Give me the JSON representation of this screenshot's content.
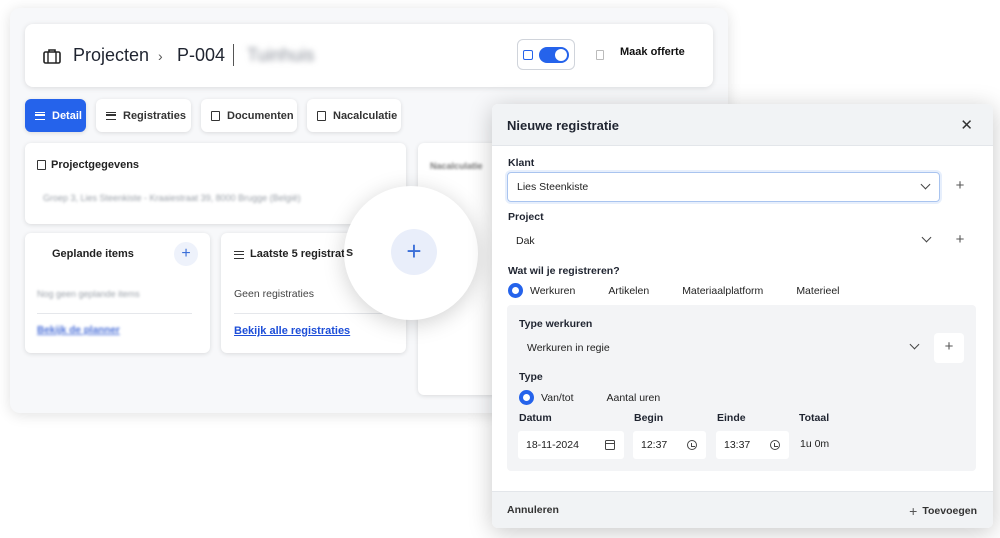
{
  "header": {
    "breadcrumb_root": "Projecten",
    "breadcrumb_separator": "›",
    "project_code": "P-004",
    "project_name": "Tuinhuis",
    "quote_button": "Maak offerte",
    "calendar_toggle_on": true
  },
  "tabs": [
    {
      "label": "Detail",
      "icon": "list-icon",
      "active": true
    },
    {
      "label": "Registraties",
      "icon": "list-icon",
      "active": false
    },
    {
      "label": "Documenten",
      "icon": "document-icon",
      "active": false
    },
    {
      "label": "Nacalculatie",
      "icon": "calculator-icon",
      "active": false
    }
  ],
  "cards": {
    "project_info": {
      "title": "Projectgegevens",
      "address": "Groep 3, Lies Steenkiste - Kraaiestraat 39, 8000 Brugge (België)"
    },
    "planned": {
      "title": "Geplande items",
      "empty": "Nog geen geplande items",
      "link": "Bekijk de planner"
    },
    "latest": {
      "title": "Laatste 5 registraties",
      "empty": "Geen registraties",
      "link": "Bekijk alle registraties"
    },
    "right": {
      "title": "Nacalculatie"
    }
  },
  "magnifier": {
    "partial_text": "s",
    "button": "+"
  },
  "modal": {
    "title": "Nieuwe registratie",
    "close": "✕",
    "customer_label": "Klant",
    "customer_value": "Lies Steenkiste",
    "project_label": "Project",
    "project_value": "Dak",
    "register_question": "Wat wil je registreren?",
    "register_options": [
      "Werkuren",
      "Artikelen",
      "Materiaalplatform",
      "Materieel"
    ],
    "register_selected": "Werkuren",
    "work_type_label": "Type werkuren",
    "work_type_value": "Werkuren in regie",
    "type_label": "Type",
    "type_options": [
      "Van/tot",
      "Aantal uren"
    ],
    "type_selected": "Van/tot",
    "date_label": "Datum",
    "date_value": "18-11-2024",
    "start_label": "Begin",
    "start_value": "12:37",
    "end_label": "Einde",
    "end_value": "13:37",
    "total_label": "Totaal",
    "total_value": "1u 0m",
    "cancel": "Annuleren",
    "add": "Toevoegen",
    "plus": "+"
  },
  "colors": {
    "accent": "#2563eb",
    "link": "#1d4ed8",
    "panel_bg": "#f3f4f6"
  }
}
